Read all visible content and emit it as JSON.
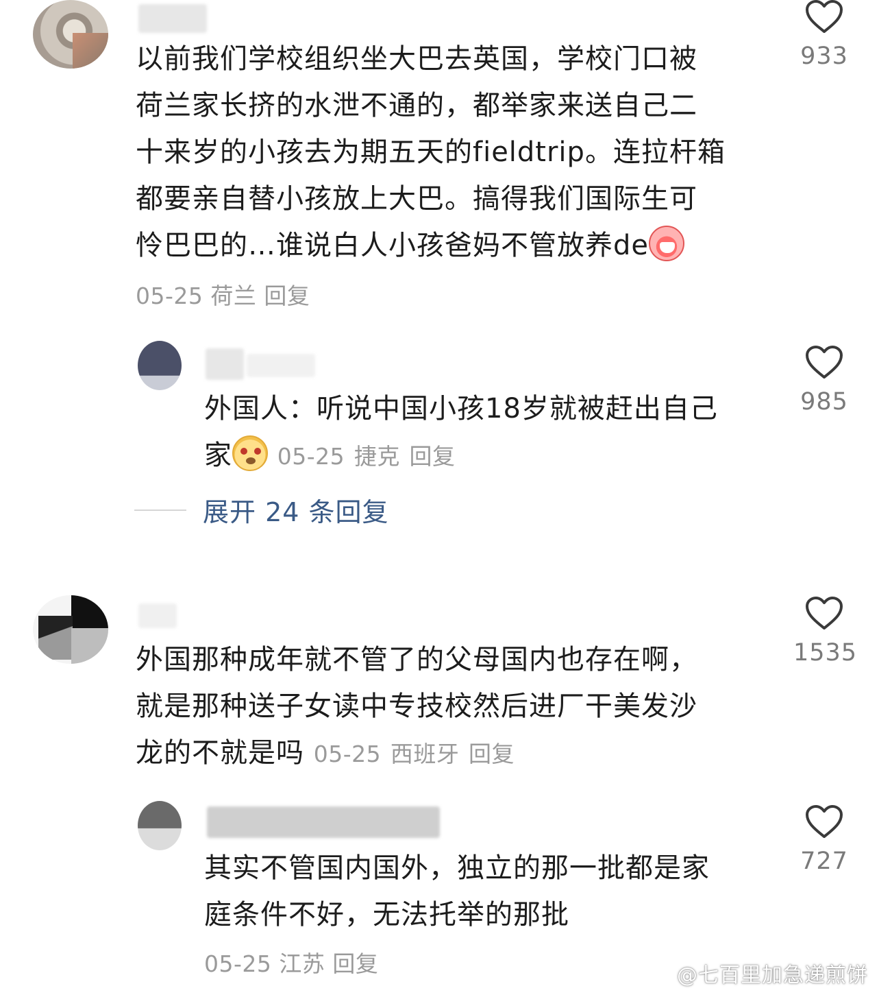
{
  "comments": [
    {
      "text": "以前我们学校组织坐大巴去英国，学校门口被荷兰家长挤的水泄不通的，都举家来送自己二十来岁的小孩去为期五天的fieldtrip。连拉杆箱都要亲自替小孩放上大巴。搞得我们国际生可怜巴巴的…谁说白人小孩爸妈不管放养de",
      "emoji": "cry-face-icon",
      "date": "05-25",
      "location": "荷兰",
      "reply": "回复",
      "likes": "933"
    },
    {
      "text": "外国人：听说中国小孩18岁就被赶出自己家",
      "emoji": "dog-face-icon",
      "date": "05-25",
      "location": "捷克",
      "reply": "回复",
      "likes": "985"
    },
    {
      "text": "外国那种成年就不管了的父母国内也存在啊，就是那种送子女读中专技校然后进厂干美发沙龙的不就是吗",
      "date": "05-25",
      "location": "西班牙",
      "reply": "回复",
      "likes": "1535"
    },
    {
      "text": "其实不管国内国外，独立的那一批都是家庭条件不好，无法托举的那批",
      "date": "05-25",
      "location": "江苏",
      "reply": "回复",
      "likes": "727"
    }
  ],
  "expand_replies": "展开 24 条回复",
  "watermark": "@七百里加急递煎饼",
  "colors": {
    "text": "#1c1c1c",
    "meta": "#9a9a9a",
    "link": "#3a5a86",
    "heart": "#3a3a3a"
  }
}
